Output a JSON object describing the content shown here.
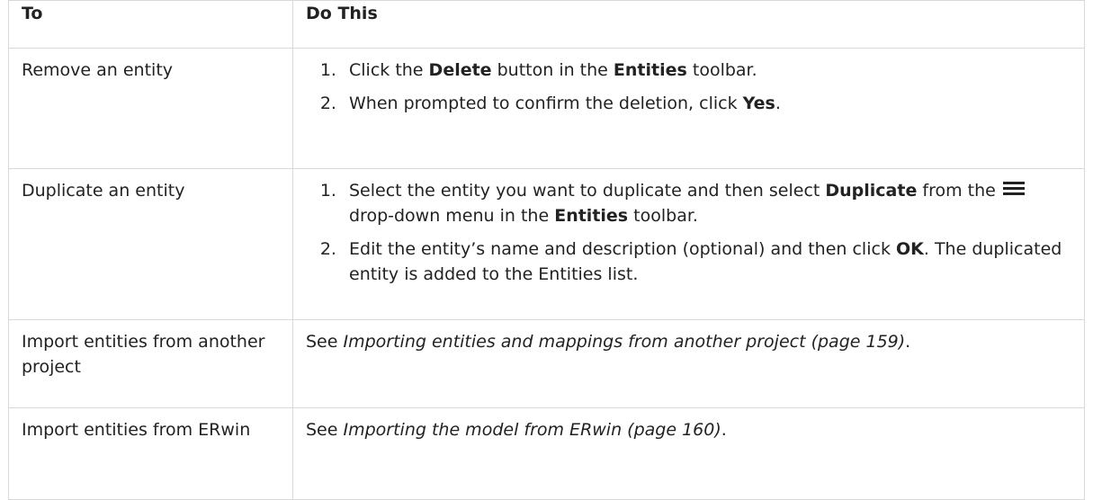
{
  "table": {
    "header": {
      "to": "To",
      "do_this": "Do This"
    },
    "row_remove": {
      "to": "Remove an entity",
      "step1": {
        "pre": "Click the ",
        "b1": "Delete",
        "mid": " button in the ",
        "b2": "Entities",
        "post": " toolbar."
      },
      "step2": {
        "pre": "When prompted to confirm the deletion, click ",
        "b1": "Yes",
        "post": "."
      }
    },
    "row_duplicate": {
      "to": "Duplicate an entity",
      "step1": {
        "pre": "Select the entity you want to duplicate and then select ",
        "b1": "Duplicate",
        "mid1": " from the ",
        "icon": "hamburger-menu-icon",
        "mid2": " drop-down menu in the ",
        "b2": "Entities",
        "post": " toolbar."
      },
      "step2": {
        "pre": "Edit the entity’s name and description (optional) and then click ",
        "b1": "OK",
        "post": ". The duplicated entity is added to the Entities list."
      }
    },
    "row_import_project": {
      "to": "Import entities from another project",
      "pre": "See ",
      "link": "Importing entities and mappings from another project (page 159)",
      "post": "."
    },
    "row_import_erwin": {
      "to": "Import entities from ERwin",
      "pre": "See ",
      "link": "Importing the model from ERwin (page 160)",
      "post": "."
    }
  }
}
